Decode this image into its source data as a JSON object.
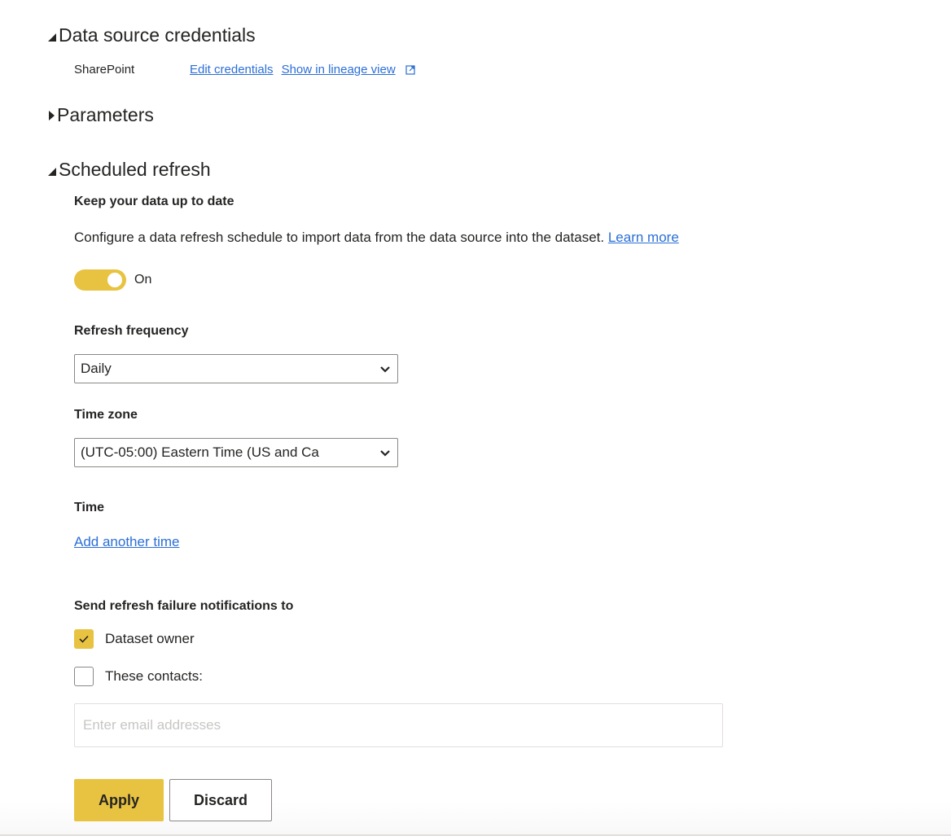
{
  "sections": {
    "data_source_credentials": {
      "title": "Data source credentials",
      "expanded": true,
      "source_name": "SharePoint",
      "edit_credentials_link": "Edit credentials",
      "lineage_link": "Show in lineage view",
      "lineage_icon": "external-link-icon"
    },
    "parameters": {
      "title": "Parameters",
      "expanded": false
    },
    "scheduled_refresh": {
      "title": "Scheduled refresh",
      "expanded": true,
      "heading": "Keep your data up to date",
      "description": "Configure a data refresh schedule to import data from the data source into the dataset.",
      "learn_more_link": "Learn more",
      "toggle": {
        "state": "on",
        "label": "On"
      },
      "refresh_frequency": {
        "label": "Refresh frequency",
        "selected": "Daily"
      },
      "time_zone": {
        "label": "Time zone",
        "selected": "(UTC-05:00) Eastern Time (US and Ca"
      },
      "time": {
        "label": "Time",
        "add_link": "Add another time"
      },
      "notifications": {
        "label": "Send refresh failure notifications to",
        "options": [
          {
            "label": "Dataset owner",
            "checked": true
          },
          {
            "label": "These contacts:",
            "checked": false
          }
        ],
        "email_placeholder": "Enter email addresses",
        "email_value": ""
      }
    }
  },
  "actions": {
    "apply_label": "Apply",
    "discard_label": "Discard"
  },
  "colors": {
    "accent": "#e8c341",
    "link": "#2b6fd6",
    "text": "#252423"
  }
}
